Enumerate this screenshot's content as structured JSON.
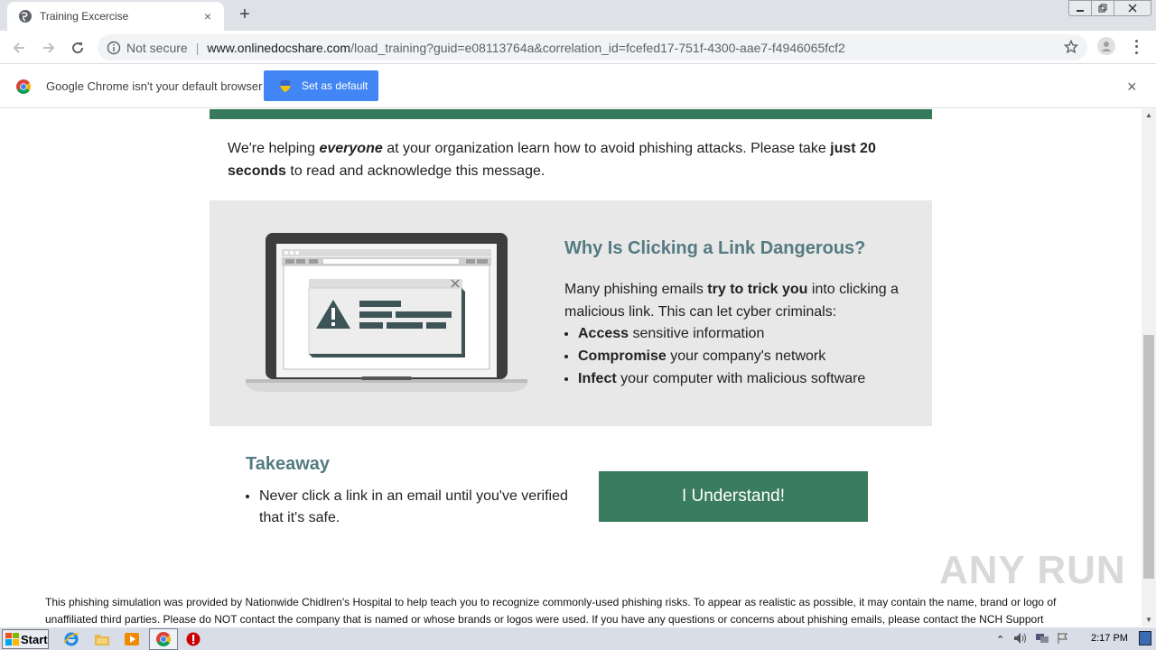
{
  "browser": {
    "tab_title": "Training Excercise",
    "new_tab": "+",
    "tab_close": "×",
    "security_label": "Not secure",
    "url_host": "www.onlinedocshare.com",
    "url_path": "/load_training?guid=e08113764a&correlation_id=fcefed17-751f-4300-aae7-f4946065fcf2"
  },
  "infobar": {
    "message": "Google Chrome isn't your default browser",
    "button_label": "Set as default",
    "close": "×"
  },
  "page": {
    "intro": {
      "part1": "We're helping ",
      "em": "everyone",
      "part2": " at your organization learn how to avoid phishing attacks. Please take ",
      "strong": "just 20 seconds",
      "part3": " to read and acknowledge this message."
    },
    "why": {
      "title": "Why Is Clicking a Link Dangerous?",
      "text_part1": "Many phishing emails ",
      "text_strong": "try to trick you",
      "text_part2": " into clicking a malicious link. This can let cyber criminals:",
      "items": [
        {
          "strong": "Access",
          "rest": " sensitive information"
        },
        {
          "strong": "Compromise",
          "rest": " your company's network"
        },
        {
          "strong": "Infect",
          "rest": " your computer with malicious software"
        }
      ]
    },
    "takeaway": {
      "title": "Takeaway",
      "item": "Never click a link in an email until you've verified that it's safe."
    },
    "button_label": "I Understand!",
    "footer": "This phishing simulation was provided by Nationwide Chidlren's Hospital to help teach you to recognize commonly-used phishing risks. To appear as realistic as possible, it may contain the name, brand or logo of unaffiliated third parties. Please do NOT contact the company that is named or whose brands or logos were used. If you have any questions or concerns about phishing emails, please contact the NCH Support",
    "watermark": "ANY RUN"
  },
  "taskbar": {
    "start_label": "Start",
    "clock": "2:17 PM"
  },
  "colors": {
    "brand_green": "#3a7c5e",
    "heading_teal": "#547a82",
    "chrome_blue": "#4285f4"
  }
}
